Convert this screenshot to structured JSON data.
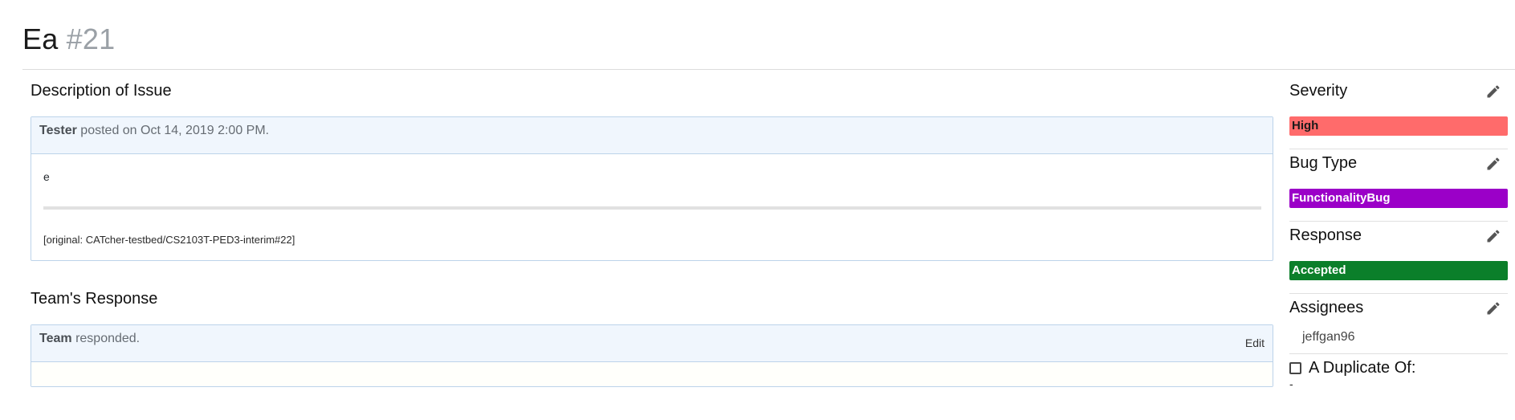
{
  "issue": {
    "title": "Ea",
    "number": "#21"
  },
  "description": {
    "section_title": "Description of Issue",
    "author": "Tester",
    "posted_text": "posted on Oct 14, 2019 2:00 PM.",
    "body_text": "e",
    "original_ref": "[original: CATcher-testbed/CS2103T-PED3-interim#22]"
  },
  "response": {
    "section_title": "Team's Response",
    "author": "Team",
    "action_text": "responded.",
    "edit_label": "Edit"
  },
  "sidebar": {
    "severity": {
      "title": "Severity",
      "value": "High",
      "color": "#ff6b6b",
      "text_color": "#1a1a1a",
      "icon": "pencil-icon"
    },
    "bug_type": {
      "title": "Bug Type",
      "value": "FunctionalityBug",
      "color": "#9b00c8",
      "text_color": "#ffffff",
      "icon": "pencil-icon"
    },
    "response": {
      "title": "Response",
      "value": "Accepted",
      "color": "#0b7f2a",
      "text_color": "#ffffff",
      "icon": "pencil-icon"
    },
    "assignees": {
      "title": "Assignees",
      "items": [
        "jeffgan96"
      ],
      "icon": "pencil-icon"
    },
    "duplicate": {
      "label": "A Duplicate Of:",
      "checked": false,
      "value": "-"
    }
  },
  "colors": {
    "comment_header_bg": "#f0f6fd",
    "comment_border": "#bcd3ea",
    "issue_number": "#9aa0a6"
  }
}
